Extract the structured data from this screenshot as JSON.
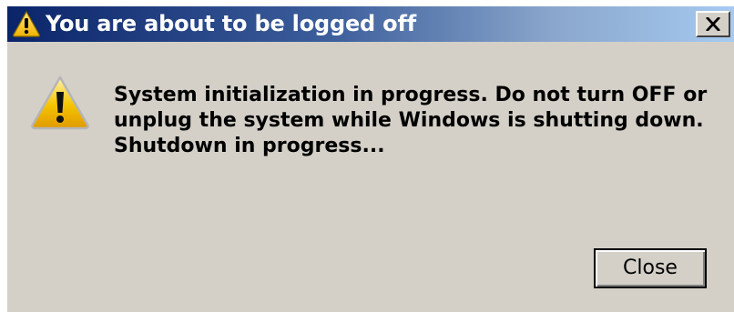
{
  "dialog": {
    "title": "You are about to be logged off",
    "title_icon": "warning-icon",
    "close_icon": "close-icon",
    "message_icon": "warning-icon",
    "message_lines": [
      "System initialization in progress. Do not turn OFF or",
      "unplug the system while Windows is shutting down.",
      "Shutdown in progress..."
    ],
    "close_button_label": "Close"
  },
  "colors": {
    "titlebar_start": "#0a246a",
    "titlebar_end": "#a6caf0",
    "dialog_background": "#d4d0c8",
    "warning_yellow": "#f5c400"
  }
}
